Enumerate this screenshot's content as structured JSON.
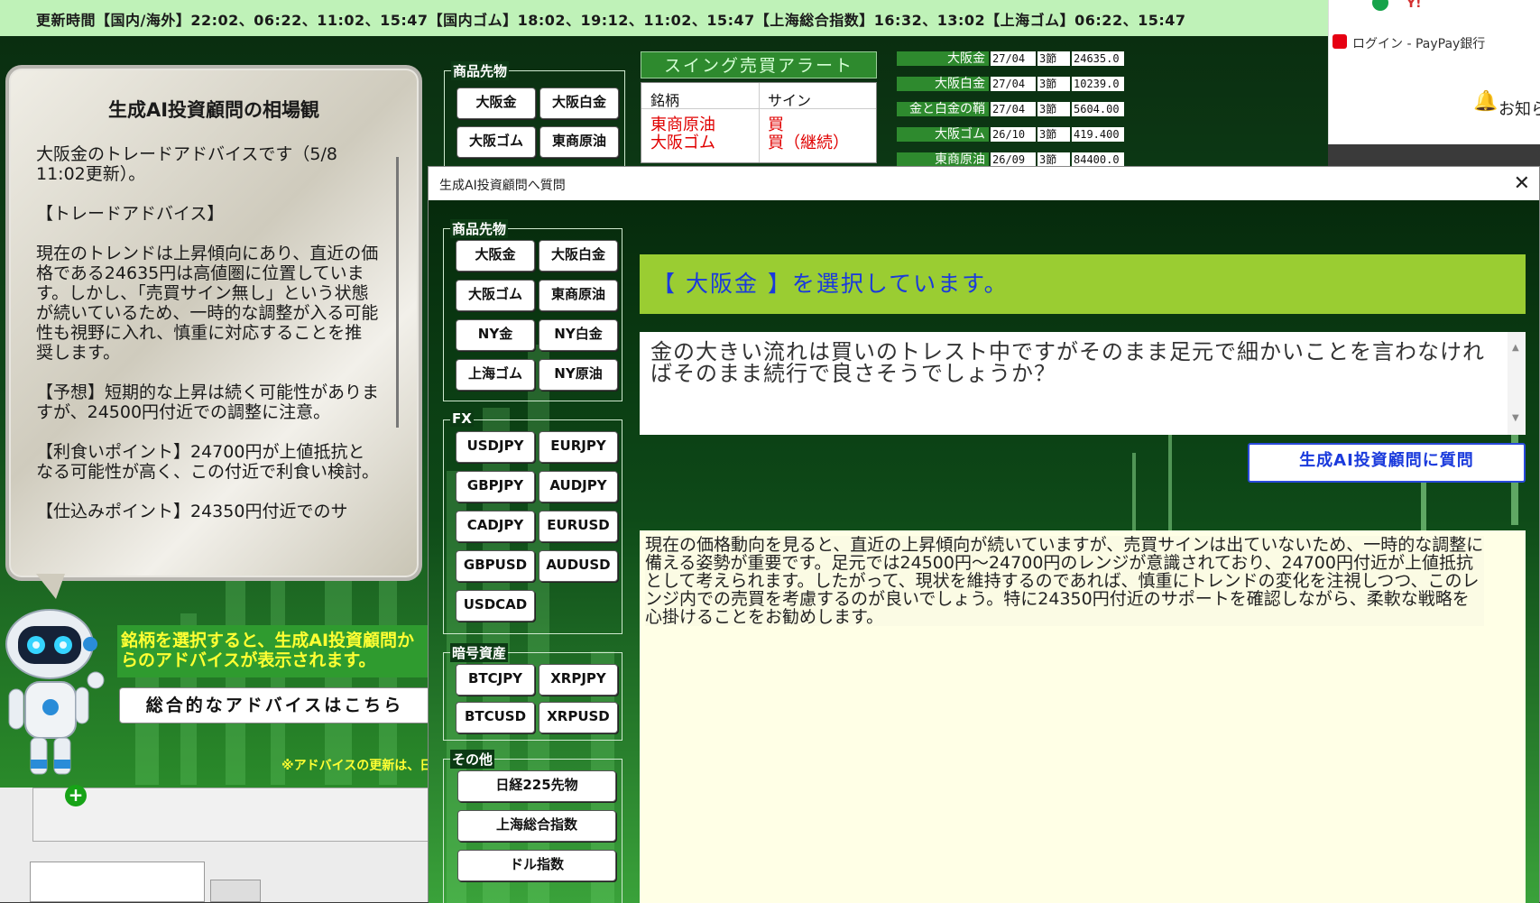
{
  "browser": {
    "tab_text": "ログイン - PayPay銀行",
    "notify": "お知ら"
  },
  "topbar": {
    "text": "更新時間【国内/海外】22:02、06:22、11:02、15:47【国内ゴム】18:02、19:12、11:02、15:47【上海総合指数】16:32、13:02【上海ゴム】06:22、15:47"
  },
  "bubble": {
    "title": "生成AI投資顧問の相場観",
    "body": "大阪金のトレードアドバイスです（5/8 11:02更新）。\n\n【トレードアドバイス】\n\n現在のトレンドは上昇傾向にあり、直近の価格である24635円は高値圏に位置しています。しかし、「売買サイン無し」という状態が続いているため、一時的な調整が入る可能性も視野に入れ、慎重に対応することを推奨します。\n\n【予想】短期的な上昇は続く可能性がありますが、24500円付近での調整に注意。\n\n【利食いポイント】24700円が上値抵抗となる可能性が高く、この付近で利食い検討。\n\n【仕込みポイント】24350円付近でのサ"
  },
  "hint": "銘柄を選択すると、生成AI投資顧問からのアドバイスが表示されます。",
  "overall_button": "総合的なアドバイスはこちら",
  "advice_note": "※アドバイスの更新は、日",
  "app_group": {
    "label": "商品先物",
    "buttons": [
      "大阪金",
      "大阪白金",
      "大阪ゴム",
      "東商原油"
    ]
  },
  "swing": {
    "title": "スイング売買アラート",
    "col_name": "銘柄",
    "col_sign": "サイン",
    "rows": [
      {
        "name": "東商原油",
        "sign": "買"
      },
      {
        "name": "大阪ゴム",
        "sign": "買（継続）"
      }
    ]
  },
  "prices": [
    {
      "name": "大阪金",
      "date": "27/04",
      "sess": "3節",
      "price": "24635.0"
    },
    {
      "name": "大阪白金",
      "date": "27/04",
      "sess": "3節",
      "price": "10239.0"
    },
    {
      "name": "金と白金の鞘",
      "date": "27/04",
      "sess": "3節",
      "price": "5604.00"
    },
    {
      "name": "大阪ゴム",
      "date": "26/10",
      "sess": "3節",
      "price": "419.400"
    },
    {
      "name": "東商原油",
      "date": "26/09",
      "sess": "3節",
      "price": "84400.0"
    }
  ],
  "dialog": {
    "title": "生成AI投資顧問へ質問",
    "close": "✕",
    "selected": "【 大阪金 】を選択しています。",
    "question": "金の大きい流れは買いのトレスト中ですがそのまま足元で細かいことを言わなければそのまま続行で良さそうでしょうか？",
    "ask_button": "生成AI投資顧問に質問",
    "answer": "現在の価格動向を見ると、直近の上昇傾向が続いていますが、売買サインは出ていないため、一時的な調整に備える姿勢が重要です。足元では24500円～24700円のレンジが意識されており、24700円付近が上値抵抗として考えられます。したがって、現状を維持するのであれば、慎重にトレンドの変化を注視しつつ、このレンジ内での売買を考慮するのが良いでしょう。特に24350円付近のサポートを確認しながら、柔軟な戦略を心掛けることをお勧めします。",
    "groups": {
      "commodity_label": "商品先物",
      "commodity": [
        "大阪金",
        "大阪白金",
        "大阪ゴム",
        "東商原油",
        "NY金",
        "NY白金",
        "上海ゴム",
        "NY原油"
      ],
      "fx_label": "FX",
      "fx": [
        "USDJPY",
        "EURJPY",
        "GBPJPY",
        "AUDJPY",
        "CADJPY",
        "EURUSD",
        "GBPUSD",
        "AUDUSD",
        "USDCAD"
      ],
      "crypto_label": "暗号資産",
      "crypto": [
        "BTCJPY",
        "XRPJPY",
        "BTCUSD",
        "XRPUSD"
      ],
      "other_label": "その他",
      "other": [
        "日経225先物",
        "上海総合指数",
        "ドル指数"
      ]
    }
  }
}
